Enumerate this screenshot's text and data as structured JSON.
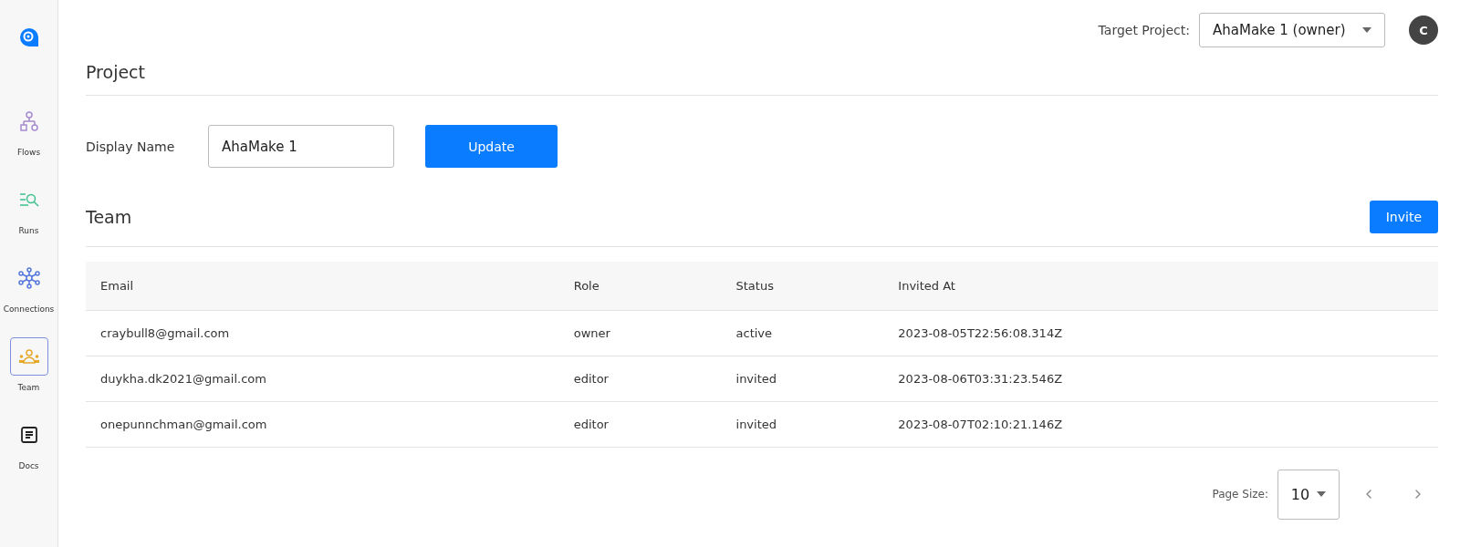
{
  "sidebar": {
    "items": [
      {
        "kind": "flows",
        "label": "Flows",
        "selected": false
      },
      {
        "kind": "runs",
        "label": "Runs",
        "selected": false
      },
      {
        "kind": "connections",
        "label": "Connections",
        "selected": false
      },
      {
        "kind": "team",
        "label": "Team",
        "selected": true
      },
      {
        "kind": "docs",
        "label": "Docs",
        "selected": false
      }
    ]
  },
  "header": {
    "target_label": "Target Project:",
    "target_value": "AhaMake 1 (owner)",
    "avatar": "C"
  },
  "project": {
    "title": "Project",
    "display_name_label": "Display Name",
    "display_name_value": "AhaMake 1",
    "update_button": "Update"
  },
  "team": {
    "title": "Team",
    "invite_button": "Invite",
    "table": {
      "columns": [
        "Email",
        "Role",
        "Status",
        "Invited At"
      ],
      "rows": [
        [
          "craybull8@gmail.com",
          "owner",
          "active",
          "2023-08-05T22:56:08.314Z"
        ],
        [
          "duykha.dk2021@gmail.com",
          "editor",
          "invited",
          "2023-08-06T03:31:23.546Z"
        ],
        [
          "onepunnchman@gmail.com",
          "editor",
          "invited",
          "2023-08-07T02:10:21.146Z"
        ]
      ]
    },
    "pagination": {
      "label": "Page Size:",
      "value": "10"
    }
  }
}
